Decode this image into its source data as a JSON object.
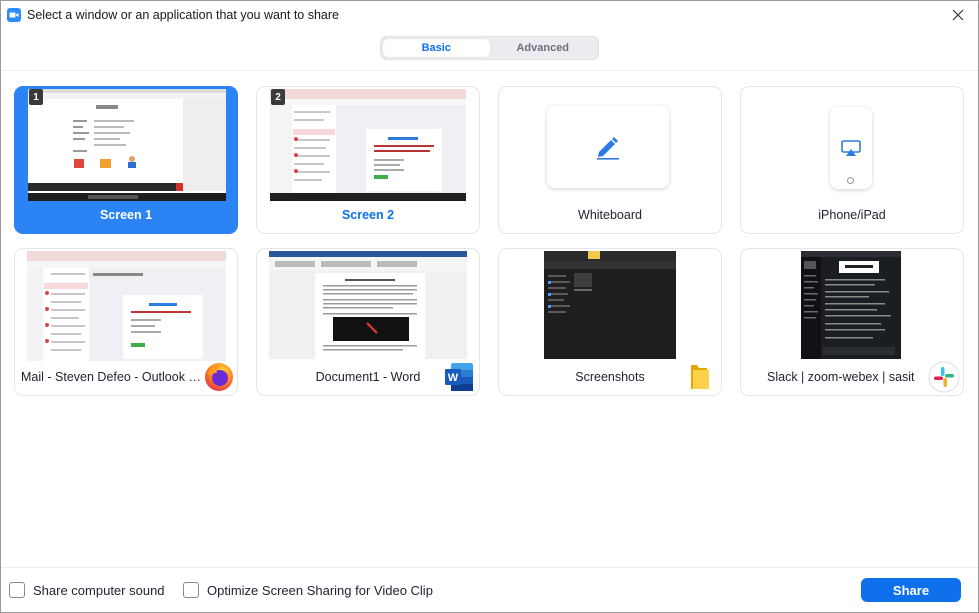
{
  "window": {
    "title": "Select a window or an application that you want to share",
    "close_icon": "close-icon",
    "app_icon": "zoom-camera-icon"
  },
  "tabs": [
    {
      "label": "Basic",
      "active": true
    },
    {
      "label": "Advanced",
      "active": false
    }
  ],
  "tiles": [
    {
      "label": "Screen 1",
      "number": "1",
      "selected": true
    },
    {
      "label": "Screen 2",
      "number": "2",
      "selected": false
    },
    {
      "label": "Whiteboard",
      "icon": "pen-icon"
    },
    {
      "label": "iPhone/iPad",
      "icon": "airplay-icon"
    },
    {
      "label": "Mail - Steven Defeo - Outlook - ...",
      "icon": "firefox-icon"
    },
    {
      "label": "Document1 - Word",
      "icon": "word-icon"
    },
    {
      "label": "Screenshots",
      "icon": "folder-icon"
    },
    {
      "label": "Slack | zoom-webex | sasit",
      "icon": "slack-icon"
    }
  ],
  "footer": {
    "share_sound": "Share computer sound",
    "optimize_video": "Optimize Screen Sharing for Video Clip",
    "share_button": "Share"
  },
  "colors": {
    "accent": "#0e71eb",
    "selected_tile": "#2c83f4"
  }
}
